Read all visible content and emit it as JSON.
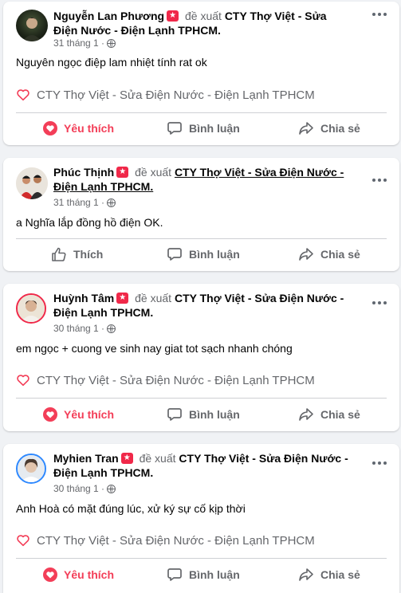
{
  "reviews": [
    {
      "name": "Nguyễn Lan Phương",
      "verb": "đề xuất",
      "page": "CTY Thợ Việt - Sửa Điện Nước - Điện Lạnh TPHCM.",
      "date": "31 tháng 1 ·",
      "text": "Nguyên ngọc điệp lam nhiệt tính rat ok",
      "recommend_label": "CTY Thợ Việt - Sửa Điện Nước - Điện Lạnh TPHCM",
      "like_label": "Yêu thích",
      "comment_label": "Bình luận",
      "share_label": "Chia sẻ"
    },
    {
      "name": "Phúc Thịnh",
      "verb": "đề xuất",
      "page": "CTY Thợ Việt - Sửa Điện Nước - Điện Lạnh TPHCM.",
      "date": "31 tháng 1 ·",
      "text": "a Nghĩa lắp đồng hồ điện OK.",
      "like_label": "Thích",
      "comment_label": "Bình luận",
      "share_label": "Chia sẻ"
    },
    {
      "name": "Huỳnh Tâm",
      "verb": "đề xuất",
      "page": "CTY Thợ Việt - Sửa Điện Nước - Điện Lạnh TPHCM.",
      "date": "30 tháng 1 ·",
      "text": "em ngọc + cuong ve sinh nay giat tot sạch  nhanh chóng",
      "recommend_label": "CTY Thợ Việt - Sửa Điện Nước - Điện Lạnh TPHCM",
      "like_label": "Yêu thích",
      "comment_label": "Bình luận",
      "share_label": "Chia sẻ"
    },
    {
      "name": "Myhien Tran",
      "verb": "đề xuất",
      "page": "CTY Thợ Việt - Sửa Điện Nước - Điện Lạnh TPHCM.",
      "date": "30 tháng 1 ·",
      "text": "Anh Hoà có mặt đúng lúc, xử ký sự cố kịp thời",
      "recommend_label": "CTY Thợ Việt - Sửa Điện Nước - Điện Lạnh TPHCM",
      "like_label": "Yêu thích",
      "comment_label": "Bình luận",
      "share_label": "Chia sẻ"
    }
  ],
  "colors": {
    "background": "#f0f2f5",
    "card": "#ffffff",
    "secondary_text": "#65676b",
    "love_red": "#f33e58",
    "badge_red": "#f02849"
  },
  "icons": [
    "recommend-badge-icon",
    "globe-icon",
    "more-options-icon",
    "heart-icon",
    "like-thumb-icon",
    "comment-icon",
    "share-icon"
  ]
}
